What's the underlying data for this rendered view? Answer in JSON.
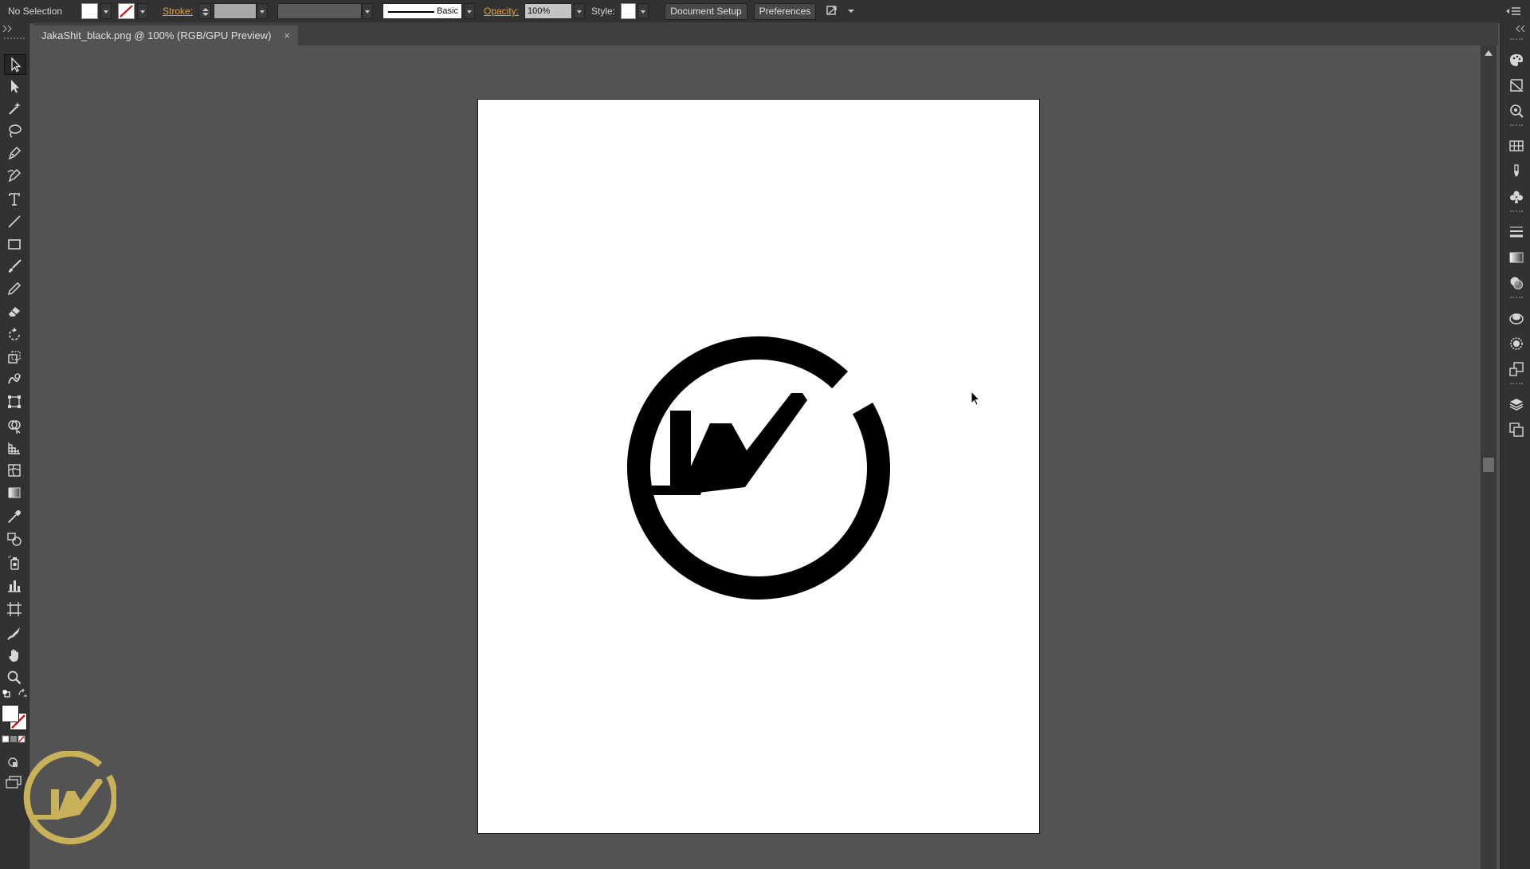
{
  "control_bar": {
    "selection_status": "No Selection",
    "stroke_label": "Stroke:",
    "brush_label": "Basic",
    "opacity_label": "Opacity:",
    "opacity_value": "100%",
    "style_label": "Style:",
    "document_setup_label": "Document Setup",
    "preferences_label": "Preferences"
  },
  "document_tab": {
    "title": "JakaShit_black.png @ 100% (RGB/GPU Preview)",
    "close": "×"
  },
  "tools": [
    "selection-tool",
    "direct-selection-tool",
    "magic-wand-tool",
    "lasso-tool",
    "pen-tool",
    "curvature-tool",
    "type-tool",
    "line-segment-tool",
    "rectangle-tool",
    "paintbrush-tool",
    "pencil-tool",
    "eraser-tool",
    "rotate-tool",
    "scale-tool",
    "warp-tool",
    "free-transform-tool",
    "shape-builder-tool",
    "perspective-grid-tool",
    "mesh-tool",
    "gradient-tool",
    "eyedropper-tool",
    "blend-tool",
    "symbol-sprayer-tool",
    "column-graph-tool",
    "artboard-tool",
    "slice-tool",
    "hand-tool",
    "zoom-tool"
  ],
  "panels": [
    "color-panel",
    "color-guide-panel",
    "libraries-panel",
    "swatches-panel",
    "brushes-panel",
    "symbols-panel",
    "stroke-panel",
    "gradient-panel",
    "transparency-panel",
    "appearance-panel",
    "graphic-styles-panel",
    "transform-panel",
    "layers-panel",
    "artboards-panel"
  ],
  "colors": {
    "ui_dark": "#323232",
    "canvas_bg": "#535353",
    "accent_label": "#e8a33b",
    "logo": "#000000",
    "watermark": "#c9b15a"
  }
}
